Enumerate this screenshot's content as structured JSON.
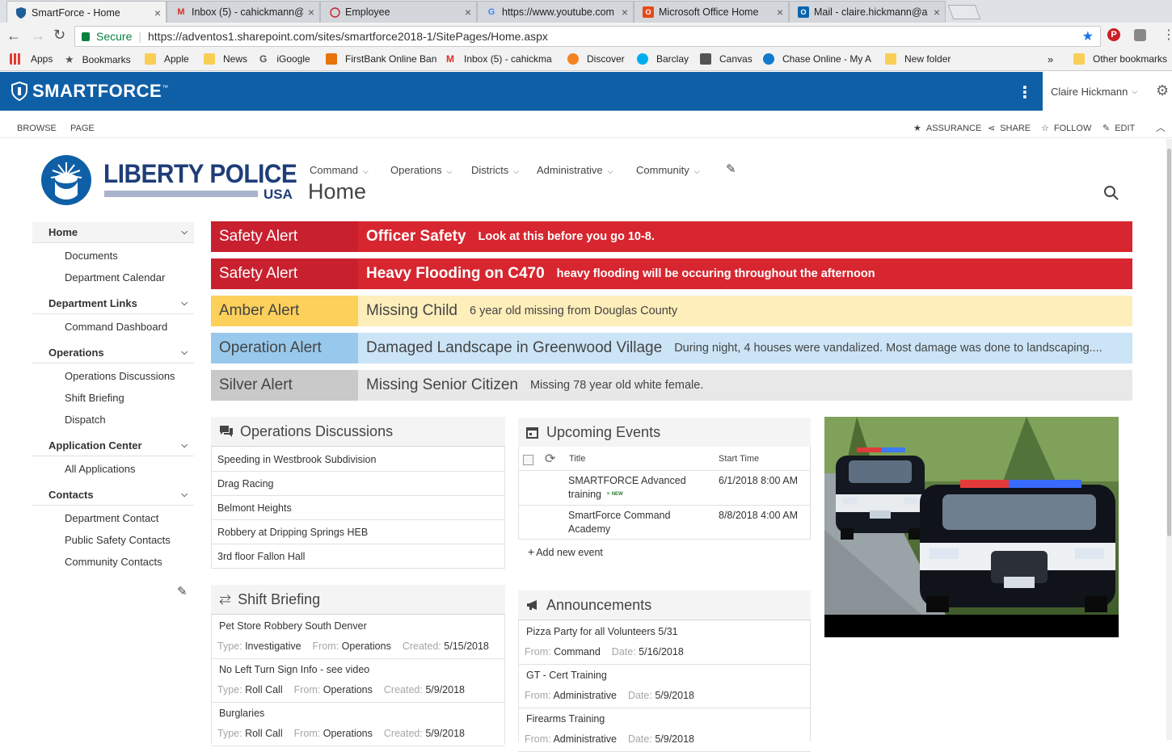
{
  "browser": {
    "tabs": [
      {
        "title": "SmartForce - Home",
        "icon": "shield-icon",
        "active": true
      },
      {
        "title": "Inbox (5) - cahickmann@",
        "icon": "gmail-icon"
      },
      {
        "title": "Employee",
        "icon": "circle-icon"
      },
      {
        "title": "https://www.youtube.com",
        "icon": "google-icon"
      },
      {
        "title": "Microsoft Office Home",
        "icon": "office-icon"
      },
      {
        "title": "Mail - claire.hickmann@a",
        "icon": "outlook-icon"
      }
    ],
    "secure_label": "Secure",
    "url": "https://adventos1.sharepoint.com/sites/smartforce2018-1/SitePages/Home.aspx",
    "bookmarks": [
      "Apps",
      "Bookmarks",
      "Apple",
      "News",
      "iGoogle",
      "FirstBank Online Ban",
      "Inbox (5) - cahickma",
      "Discover",
      "Barclay",
      "Canvas",
      "Chase Online - My A",
      "New folder"
    ],
    "bookmarks_overflow": "»",
    "other_bookmarks": "Other bookmarks"
  },
  "suite": {
    "brand": "SMARTFORCE",
    "tm": "™",
    "user": "Claire Hickmann"
  },
  "ribbon": {
    "tabs": [
      "BROWSE",
      "PAGE"
    ],
    "actions": [
      "ASSURANCE",
      "SHARE",
      "FOLLOW",
      "EDIT"
    ]
  },
  "header": {
    "logo_line1": "LIBERTY POLICE",
    "logo_line2": "USA",
    "nav": [
      "Command",
      "Operations",
      "Districts",
      "Administrative",
      "Community"
    ],
    "page_title": "Home"
  },
  "leftnav": {
    "home": "Home",
    "home_items": [
      "Documents",
      "Department Calendar"
    ],
    "groups": [
      {
        "label": "Department Links",
        "items": [
          "Command Dashboard"
        ]
      },
      {
        "label": "Operations",
        "items": [
          "Operations Discussions",
          "Shift Briefing",
          "Dispatch"
        ]
      },
      {
        "label": "Application Center",
        "items": [
          "All Applications"
        ]
      },
      {
        "label": "Contacts",
        "items": [
          "Department Contact",
          "Public Safety Contacts",
          "Community Contacts"
        ]
      }
    ]
  },
  "alerts": [
    {
      "type": "Safety Alert",
      "title": "Officer Safety",
      "desc": "Look at this before you go 10-8.",
      "label_bg": "#c8202f",
      "body_bg": "#d7262f",
      "color": "#ffffff"
    },
    {
      "type": "Safety Alert",
      "title": "Heavy Flooding on C470",
      "desc": "heavy flooding will be occuring throughout the afternoon",
      "label_bg": "#c8202f",
      "body_bg": "#d7262f",
      "color": "#ffffff"
    },
    {
      "type": "Amber Alert",
      "title": "Missing Child",
      "desc": "6 year old missing from Douglas County",
      "label_bg": "#fcd05a",
      "body_bg": "#fdeeba",
      "color": "#444444"
    },
    {
      "type": "Operation Alert",
      "title": "Damaged Landscape in Greenwood Village",
      "desc": "During night, 4 houses were vandalized. Most damage was done to landscaping....",
      "label_bg": "#98c9ec",
      "body_bg": "#cbe4f6",
      "color": "#444444"
    },
    {
      "type": "Silver Alert",
      "title": "Missing Senior Citizen",
      "desc": "Missing 78 year old white female.",
      "label_bg": "#c9c9c9",
      "body_bg": "#e8e8e8",
      "color": "#444444"
    }
  ],
  "discussions": {
    "title": "Operations Discussions",
    "items": [
      "Speeding in Westbrook Subdivision",
      "Drag Racing",
      "Belmont Heights",
      "Robbery at Dripping Springs HEB",
      "3rd floor Fallon Hall"
    ]
  },
  "events": {
    "title": "Upcoming Events",
    "col_title": "Title",
    "col_start": "Start Time",
    "rows": [
      {
        "title_line1": "SMARTFORCE Advanced",
        "title_line2": "training",
        "new_badge": "NEW",
        "start": "6/1/2018 8:00 AM"
      },
      {
        "title_line1": "SmartForce Command",
        "title_line2": "Academy",
        "start": "8/8/2018 4:00 AM"
      }
    ],
    "add_label": "Add new event"
  },
  "shift": {
    "title": "Shift Briefing",
    "labels": {
      "type": "Type:",
      "from": "From:",
      "created": "Created:"
    },
    "items": [
      {
        "title": "Pet Store Robbery South Denver",
        "type": "Investigative",
        "from": "Operations",
        "created": "5/15/2018"
      },
      {
        "title": "No Left Turn Sign Info - see video",
        "type": "Roll Call",
        "from": "Operations",
        "created": "5/9/2018"
      },
      {
        "title": "Burglaries",
        "type": "Roll Call",
        "from": "Operations",
        "created": "5/9/2018"
      }
    ]
  },
  "announcements": {
    "title": "Announcements",
    "labels": {
      "from": "From:",
      "date": "Date:"
    },
    "items": [
      {
        "title": "Pizza Party for all Volunteers 5/31",
        "from": "Command",
        "date": "5/16/2018"
      },
      {
        "title": "GT - Cert Training",
        "from": "Administrative",
        "date": "5/9/2018"
      },
      {
        "title": "Firearms Training",
        "from": "Administrative",
        "date": "5/9/2018"
      }
    ]
  }
}
